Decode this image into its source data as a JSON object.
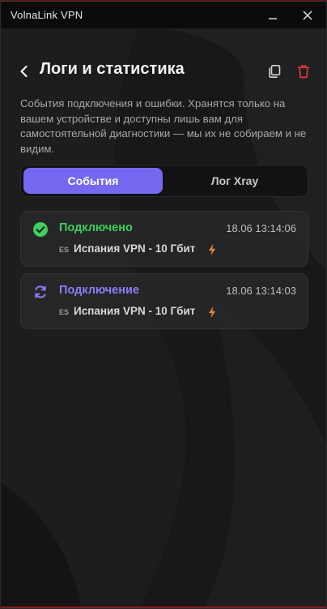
{
  "window": {
    "title": "VolnaLink VPN"
  },
  "header": {
    "title": "Логи и статистика"
  },
  "description": "События подключения и ошибки. Хранятся только на вашем устройстве и доступны лишь вам для самостоятельной диагностики — мы их не собираем и не видим.",
  "tabs": [
    {
      "label": "События",
      "active": true
    },
    {
      "label": "Лог Xray",
      "active": false
    }
  ],
  "events": [
    {
      "status": "Подключено",
      "status_color": "#3ecf5e",
      "icon": "check-circle-icon",
      "time": "18.06 13:14:06",
      "country_code": "ES",
      "server": "Испания VPN - 10 Гбит"
    },
    {
      "status": "Подключение",
      "status_color": "#8a7ff5",
      "icon": "sync-icon",
      "time": "18.06 13:14:03",
      "country_code": "ES",
      "server": "Испания VPN - 10 Гбит"
    }
  ],
  "colors": {
    "accent": "#7468f0",
    "delete": "#e0393e",
    "bolt": "#e8853a"
  }
}
